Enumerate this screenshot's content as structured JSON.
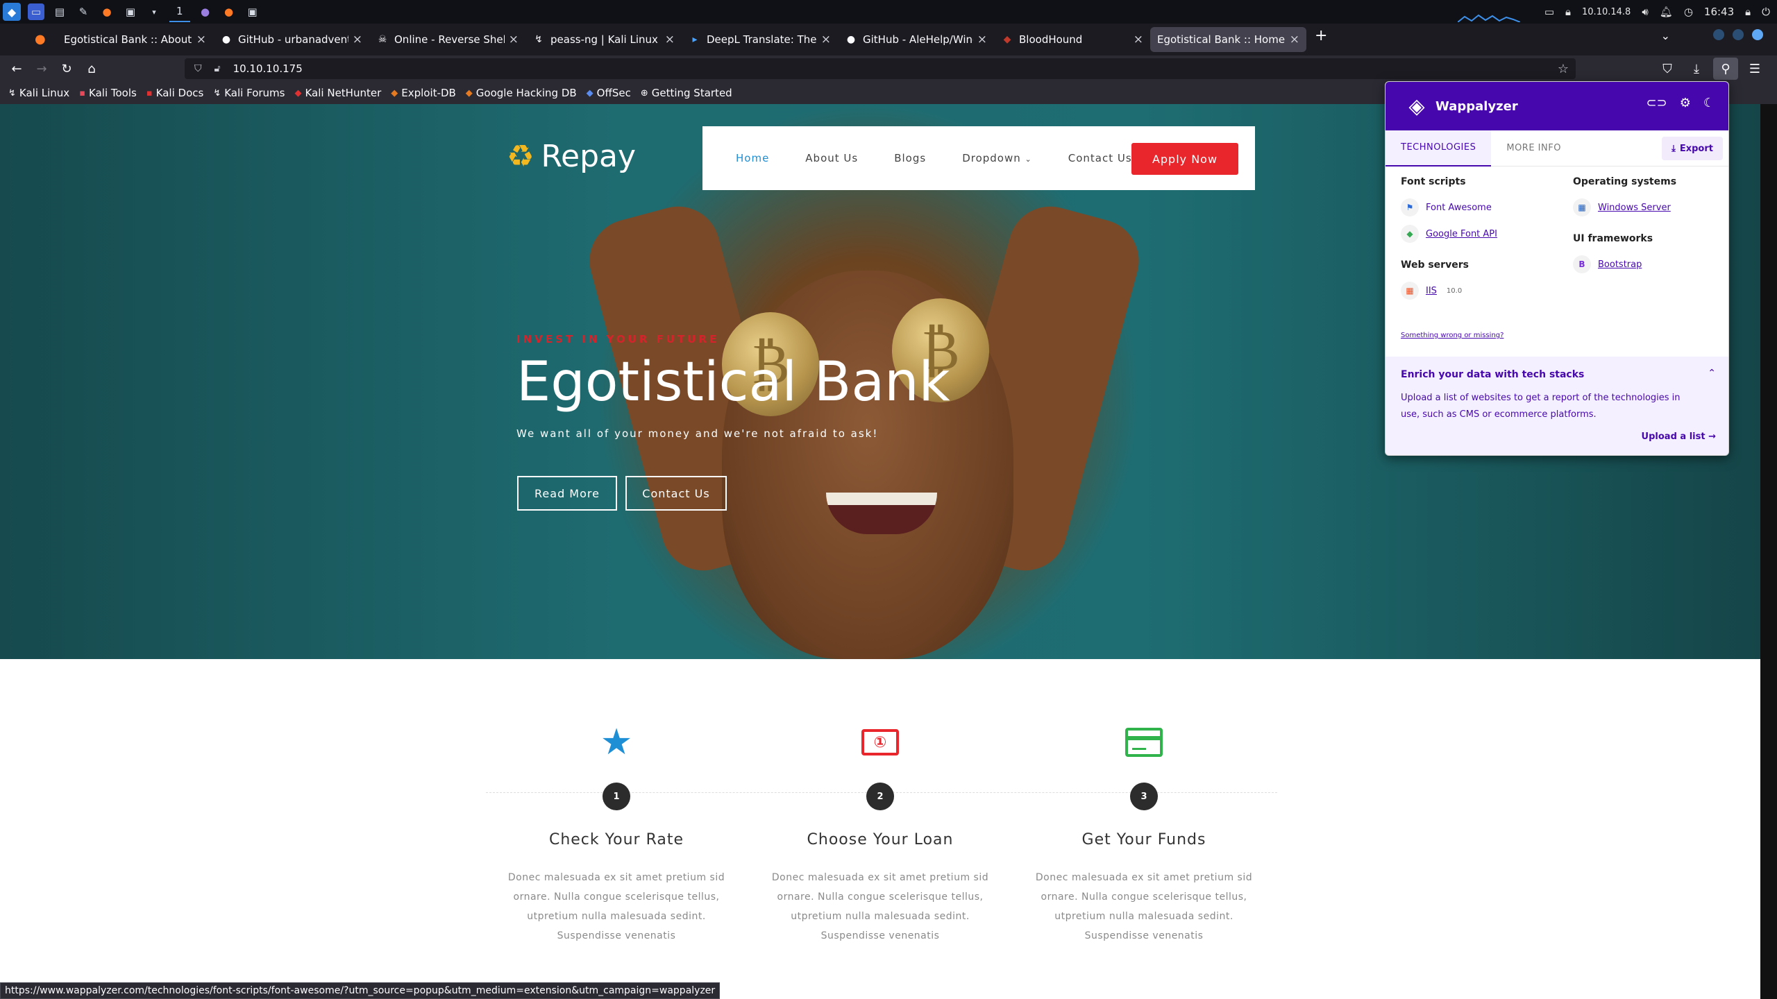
{
  "panel": {
    "workspace": "1",
    "ip": "10.10.14.8",
    "time": "16:43"
  },
  "tabs": [
    {
      "title": "Egotistical Bank :: About",
      "icon": "firefox-icon"
    },
    {
      "title": "GitHub - urbanadventurer",
      "icon": "github-icon"
    },
    {
      "title": "Online - Reverse Shell Ge",
      "icon": "skull-icon"
    },
    {
      "title": "peass-ng | Kali Linux Tool",
      "icon": "kali-icon"
    },
    {
      "title": "DeepL Translate: The wor",
      "icon": "deepl-icon"
    },
    {
      "title": "GitHub - AleHelp/Window",
      "icon": "github-icon"
    },
    {
      "title": "BloodHound",
      "icon": "bloodhound-icon"
    },
    {
      "title": "Egotistical Bank :: Home",
      "icon": ""
    }
  ],
  "url": "10.10.10.175",
  "bookmarks": [
    "Kali Linux",
    "Kali Tools",
    "Kali Docs",
    "Kali Forums",
    "Kali NetHunter",
    "Exploit-DB",
    "Google Hacking DB",
    "OffSec",
    "Getting Started"
  ],
  "site": {
    "logo": "Repay",
    "menu": [
      "Home",
      "About Us",
      "Blogs",
      "Dropdown",
      "Contact Us"
    ],
    "apply": "Apply Now",
    "tagline": "INVEST IN YOUR FUTURE",
    "title": "Egotistical Bank",
    "subtitle": "We want all of your money and we're not afraid to ask!",
    "read_more": "Read More",
    "contact_us": "Contact Us",
    "steps": [
      {
        "num": "1",
        "title": "Check Your Rate",
        "desc": "Donec malesuada ex sit amet pretium sid ornare. Nulla congue scelerisque tellus, utpretium nulla malesuada sedint. Suspendisse venenatis",
        "icon": "star-icon",
        "color": "#1f8fd5"
      },
      {
        "num": "2",
        "title": "Choose Your Loan",
        "desc": "Donec malesuada ex sit amet pretium sid ornare. Nulla congue scelerisque tellus, utpretium nulla malesuada sedint. Suspendisse venenatis",
        "icon": "money-icon",
        "color": "#e8262c"
      },
      {
        "num": "3",
        "title": "Get Your Funds",
        "desc": "Donec malesuada ex sit amet pretium sid ornare. Nulla congue scelerisque tellus, utpretium nulla malesuada sedint. Suspendisse venenatis",
        "icon": "credit-card-icon",
        "color": "#2fb34a"
      }
    ]
  },
  "status_url": "https://www.wappalyzer.com/technologies/font-scripts/font-awesome/?utm_source=popup&utm_medium=extension&utm_campaign=wappalyzer",
  "wappalyzer": {
    "title": "Wappalyzer",
    "tab_technologies": "TECHNOLOGIES",
    "tab_more_info": "MORE INFO",
    "export": "Export",
    "font_scripts_label": "Font scripts",
    "font_awesome": "Font Awesome",
    "google_font_api": "Google Font API",
    "web_servers_label": "Web servers",
    "iis": "IIS",
    "iis_version": "10.0",
    "os_label": "Operating systems",
    "windows_server": "Windows Server",
    "ui_frameworks_label": "UI frameworks",
    "bootstrap": "Bootstrap",
    "wrong": "Something wrong or missing?",
    "enrich_title": "Enrich your data with tech stacks",
    "enrich_desc": "Upload a list of websites to get a report of the technologies in use, such as CMS or ecommerce platforms.",
    "upload": "Upload a list",
    "accent": "#4608ad"
  }
}
